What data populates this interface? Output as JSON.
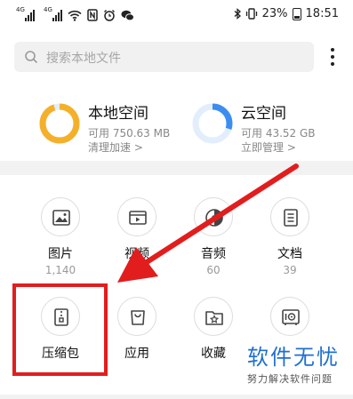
{
  "status_bar": {
    "sim1_label": "4G",
    "sim2_label": "4G",
    "battery": "23%",
    "time": "18:51",
    "icons": [
      "wifi-icon",
      "nfc-icon",
      "alarm-icon",
      "wechat-icon",
      "bluetooth-icon",
      "vibrate-icon",
      "battery-icon"
    ]
  },
  "search": {
    "placeholder": "搜索本地文件"
  },
  "storage": {
    "local": {
      "title": "本地空间",
      "available": "可用 750.63 MB",
      "action": "清理加速 >",
      "ring_color": "#f5b02a",
      "used_fraction": 0.95
    },
    "cloud": {
      "title": "云空间",
      "available": "可用 43.52 GB",
      "action": "立即管理 >",
      "ring_color": "#3b8ef0",
      "used_fraction": 0.3
    }
  },
  "categories": [
    {
      "label": "图片",
      "count": "1,140",
      "icon": "image-icon"
    },
    {
      "label": "视频",
      "count": "",
      "icon": "video-icon"
    },
    {
      "label": "音频",
      "count": "60",
      "icon": "audio-icon"
    },
    {
      "label": "文档",
      "count": "39",
      "icon": "document-icon"
    },
    {
      "label": "压缩包",
      "count": "",
      "icon": "zip-icon"
    },
    {
      "label": "应用",
      "count": "",
      "icon": "app-bag-icon"
    },
    {
      "label": "收藏",
      "count": "",
      "icon": "star-folder-icon"
    },
    {
      "label": "",
      "count": "",
      "icon": "safe-icon"
    }
  ],
  "watermark": {
    "title": "软件无忧",
    "subtitle": "努力解决软件问题"
  },
  "colors": {
    "highlight": "#e21d1d",
    "watermark": "#1f6fd1"
  }
}
